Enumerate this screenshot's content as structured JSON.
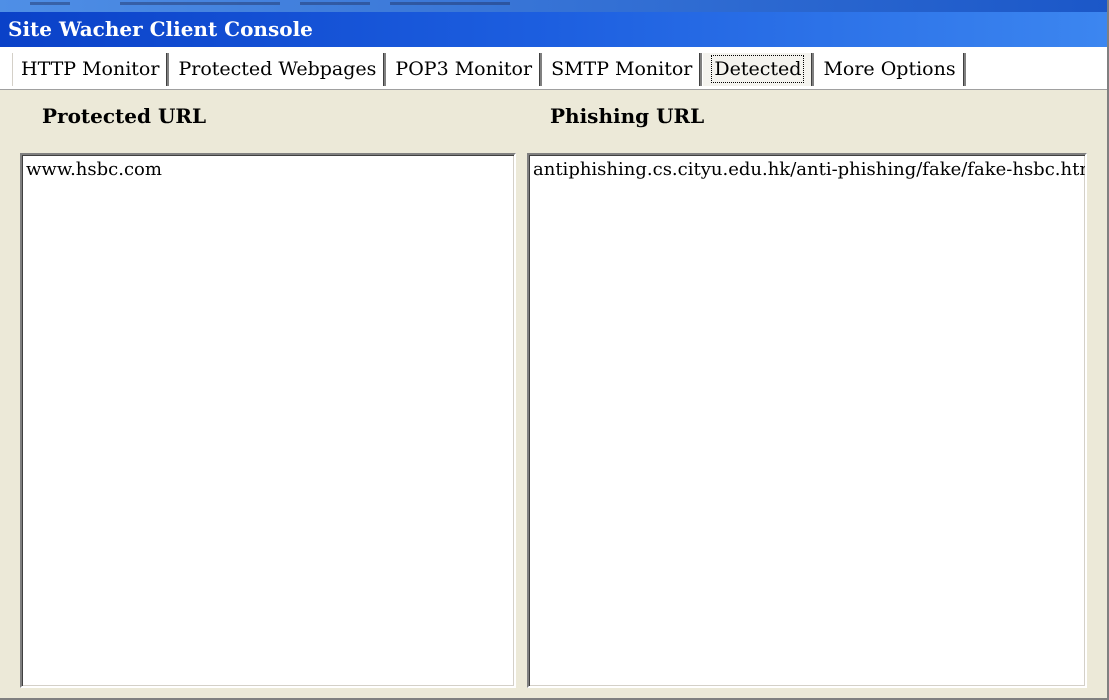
{
  "window": {
    "title": "Site Wacher Client Console"
  },
  "tabs": [
    {
      "label": "HTTP Monitor"
    },
    {
      "label": "Protected Webpages"
    },
    {
      "label": "POP3 Monitor"
    },
    {
      "label": "SMTP Monitor"
    },
    {
      "label": "Detected"
    },
    {
      "label": "More Options"
    }
  ],
  "active_tab": "Detected",
  "columns": {
    "protected_label": "Protected URL",
    "phishing_label": "Phishing URL"
  },
  "protected_urls": [
    "www.hsbc.com"
  ],
  "phishing_urls": [
    "antiphishing.cs.cityu.edu.hk/anti-phishing/fake/fake-hsbc.htm"
  ],
  "colors": {
    "titlebar": "#0a41c8",
    "window_bg": "#ece9d8"
  }
}
